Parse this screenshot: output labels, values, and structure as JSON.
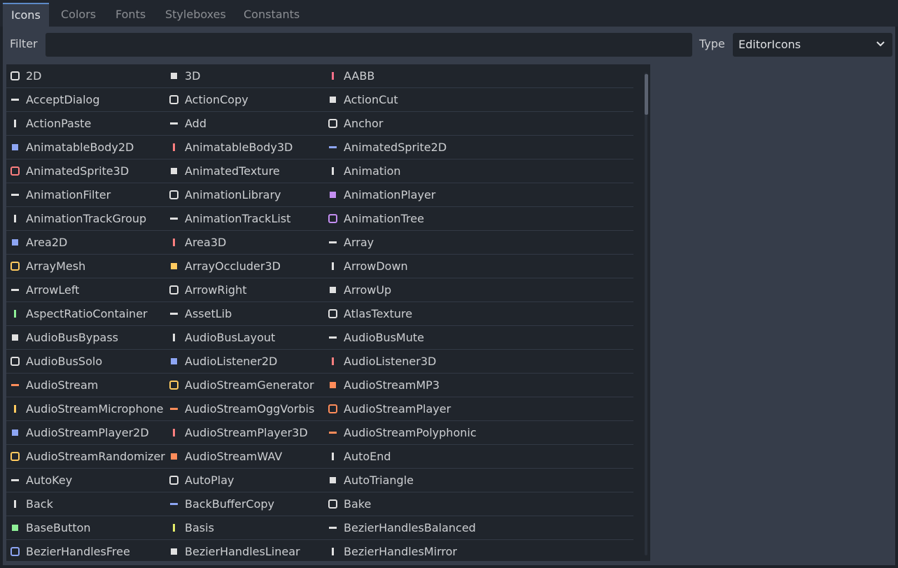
{
  "tabs": [
    "Icons",
    "Colors",
    "Fonts",
    "Styleboxes",
    "Constants"
  ],
  "filter": {
    "label": "Filter",
    "value": ""
  },
  "type": {
    "label": "Type",
    "value": "EditorIcons"
  },
  "items": [
    {
      "name": "2D",
      "icon": "2d-icon",
      "color": "#e0e0e0"
    },
    {
      "name": "3D",
      "icon": "3d-icon",
      "color": "#e0e0e0"
    },
    {
      "name": "AABB",
      "icon": "aabb-icon",
      "color": "#f5708a"
    },
    {
      "name": "AcceptDialog",
      "icon": "accept-dialog-icon",
      "color": "#e0e0e0"
    },
    {
      "name": "ActionCopy",
      "icon": "action-copy-icon",
      "color": "#e0e0e0"
    },
    {
      "name": "ActionCut",
      "icon": "action-cut-icon",
      "color": "#e0e0e0"
    },
    {
      "name": "ActionPaste",
      "icon": "action-paste-icon",
      "color": "#e0e0e0"
    },
    {
      "name": "Add",
      "icon": "add-icon",
      "color": "#e0e0e0"
    },
    {
      "name": "Anchor",
      "icon": "anchor-icon",
      "color": "#e0e0e0"
    },
    {
      "name": "AnimatableBody2D",
      "icon": "animatable-body-2d-icon",
      "color": "#8da5f3"
    },
    {
      "name": "AnimatableBody3D",
      "icon": "animatable-body-3d-icon",
      "color": "#fc7f7f"
    },
    {
      "name": "AnimatedSprite2D",
      "icon": "animated-sprite-2d-icon",
      "color": "#8da5f3"
    },
    {
      "name": "AnimatedSprite3D",
      "icon": "animated-sprite-3d-icon",
      "color": "#fc7f7f"
    },
    {
      "name": "AnimatedTexture",
      "icon": "animated-texture-icon",
      "color": "#e0e0e0"
    },
    {
      "name": "Animation",
      "icon": "animation-icon",
      "color": "#e0e0e0"
    },
    {
      "name": "AnimationFilter",
      "icon": "animation-filter-icon",
      "color": "#e0e0e0"
    },
    {
      "name": "AnimationLibrary",
      "icon": "animation-library-icon",
      "color": "#e0e0e0"
    },
    {
      "name": "AnimationPlayer",
      "icon": "animation-player-icon",
      "color": "#c38ef1"
    },
    {
      "name": "AnimationTrackGroup",
      "icon": "animation-track-group-icon",
      "color": "#e0e0e0"
    },
    {
      "name": "AnimationTrackList",
      "icon": "animation-track-list-icon",
      "color": "#e0e0e0"
    },
    {
      "name": "AnimationTree",
      "icon": "animation-tree-icon",
      "color": "#c38ef1"
    },
    {
      "name": "Area2D",
      "icon": "area-2d-icon",
      "color": "#8da5f3"
    },
    {
      "name": "Area3D",
      "icon": "area-3d-icon",
      "color": "#fc7f7f"
    },
    {
      "name": "Array",
      "icon": "array-icon",
      "color": "#e0e0e0"
    },
    {
      "name": "ArrayMesh",
      "icon": "array-mesh-icon",
      "color": "#ffca5f"
    },
    {
      "name": "ArrayOccluder3D",
      "icon": "array-occluder-3d-icon",
      "color": "#ffca5f"
    },
    {
      "name": "ArrowDown",
      "icon": "arrow-down-icon",
      "color": "#e0e0e0"
    },
    {
      "name": "ArrowLeft",
      "icon": "arrow-left-icon",
      "color": "#e0e0e0"
    },
    {
      "name": "ArrowRight",
      "icon": "arrow-right-icon",
      "color": "#e0e0e0"
    },
    {
      "name": "ArrowUp",
      "icon": "arrow-up-icon",
      "color": "#e0e0e0"
    },
    {
      "name": "AspectRatioContainer",
      "icon": "aspect-ratio-container-icon",
      "color": "#8eef97"
    },
    {
      "name": "AssetLib",
      "icon": "asset-lib-icon",
      "color": "#e0e0e0"
    },
    {
      "name": "AtlasTexture",
      "icon": "atlas-texture-icon",
      "color": "#e0e0e0"
    },
    {
      "name": "AudioBusBypass",
      "icon": "audio-bus-bypass-icon",
      "color": "#e0e0e0"
    },
    {
      "name": "AudioBusLayout",
      "icon": "audio-bus-layout-icon",
      "color": "#e0e0e0"
    },
    {
      "name": "AudioBusMute",
      "icon": "audio-bus-mute-icon",
      "color": "#e0e0e0"
    },
    {
      "name": "AudioBusSolo",
      "icon": "audio-bus-solo-icon",
      "color": "#e0e0e0"
    },
    {
      "name": "AudioListener2D",
      "icon": "audio-listener-2d-icon",
      "color": "#8da5f3"
    },
    {
      "name": "AudioListener3D",
      "icon": "audio-listener-3d-icon",
      "color": "#fc7f7f"
    },
    {
      "name": "AudioStream",
      "icon": "audio-stream-icon",
      "color": "#ff8c5a"
    },
    {
      "name": "AudioStreamGenerator",
      "icon": "audio-stream-generator-icon",
      "color": "#ffca5f"
    },
    {
      "name": "AudioStreamMP3",
      "icon": "audio-stream-mp3-icon",
      "color": "#ff8c5a"
    },
    {
      "name": "AudioStreamMicrophone",
      "icon": "audio-stream-microphone-icon",
      "color": "#ffca5f"
    },
    {
      "name": "AudioStreamOggVorbis",
      "icon": "audio-stream-ogg-vorbis-icon",
      "color": "#ff8c5a"
    },
    {
      "name": "AudioStreamPlayer",
      "icon": "audio-stream-player-icon",
      "color": "#ff8c5a"
    },
    {
      "name": "AudioStreamPlayer2D",
      "icon": "audio-stream-player-2d-icon",
      "color": "#8da5f3"
    },
    {
      "name": "AudioStreamPlayer3D",
      "icon": "audio-stream-player-3d-icon",
      "color": "#fc7f7f"
    },
    {
      "name": "AudioStreamPolyphonic",
      "icon": "audio-stream-polyphonic-icon",
      "color": "#ff8c5a"
    },
    {
      "name": "AudioStreamRandomizer",
      "icon": "audio-stream-randomizer-icon",
      "color": "#ffca5f"
    },
    {
      "name": "AudioStreamWAV",
      "icon": "audio-stream-wav-icon",
      "color": "#ff8c5a"
    },
    {
      "name": "AutoEnd",
      "icon": "auto-end-icon",
      "color": "#e0e0e0"
    },
    {
      "name": "AutoKey",
      "icon": "auto-key-icon",
      "color": "#e0e0e0"
    },
    {
      "name": "AutoPlay",
      "icon": "auto-play-icon",
      "color": "#e0e0e0"
    },
    {
      "name": "AutoTriangle",
      "icon": "auto-triangle-icon",
      "color": "#e0e0e0"
    },
    {
      "name": "Back",
      "icon": "back-icon",
      "color": "#e0e0e0"
    },
    {
      "name": "BackBufferCopy",
      "icon": "back-buffer-copy-icon",
      "color": "#8da5f3"
    },
    {
      "name": "Bake",
      "icon": "bake-icon",
      "color": "#e0e0e0"
    },
    {
      "name": "BaseButton",
      "icon": "base-button-icon",
      "color": "#8eef97"
    },
    {
      "name": "Basis",
      "icon": "basis-icon",
      "color": "#e3ec69"
    },
    {
      "name": "BezierHandlesBalanced",
      "icon": "bezier-handles-balanced-icon",
      "color": "#e0e0e0"
    },
    {
      "name": "BezierHandlesFree",
      "icon": "bezier-handles-free-icon",
      "color": "#8da5f3"
    },
    {
      "name": "BezierHandlesLinear",
      "icon": "bezier-handles-linear-icon",
      "color": "#e0e0e0"
    },
    {
      "name": "BezierHandlesMirror",
      "icon": "bezier-handles-mirror-icon",
      "color": "#e0e0e0"
    }
  ]
}
